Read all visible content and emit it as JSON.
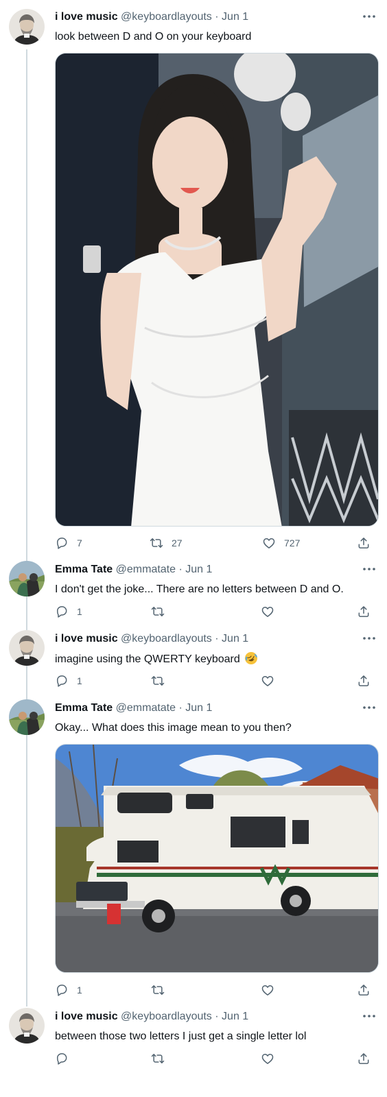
{
  "colors": {
    "text": "#0f1419",
    "secondary": "#536471",
    "line": "#cfd9de"
  },
  "tweets": [
    {
      "name": "i love music",
      "handle": "@keyboardlayouts",
      "sep": "·",
      "date": "Jun 1",
      "text": "look between D and O on your keyboard",
      "media": "photo-woman-white-dress-waving",
      "replies": "7",
      "retweets": "27",
      "likes": "727"
    },
    {
      "name": "Emma Tate",
      "handle": "@emmatate",
      "sep": "·",
      "date": "Jun 1",
      "text": "I don't get the joke... There are no letters between D and O.",
      "replies": "1"
    },
    {
      "name": "i love music",
      "handle": "@keyboardlayouts",
      "sep": "·",
      "date": "Jun 1",
      "text": "imagine using the QWERTY keyboard",
      "emoji": "rofl-emoji",
      "replies": "1"
    },
    {
      "name": "Emma Tate",
      "handle": "@emmatate",
      "sep": "·",
      "date": "Jun 1",
      "text": "Okay... What does this image mean to you then?",
      "media": "photo-rv-motorhome",
      "replies": "1"
    },
    {
      "name": "i love music",
      "handle": "@keyboardlayouts",
      "sep": "·",
      "date": "Jun 1",
      "text": "between those two letters I just get a single letter lol"
    }
  ]
}
